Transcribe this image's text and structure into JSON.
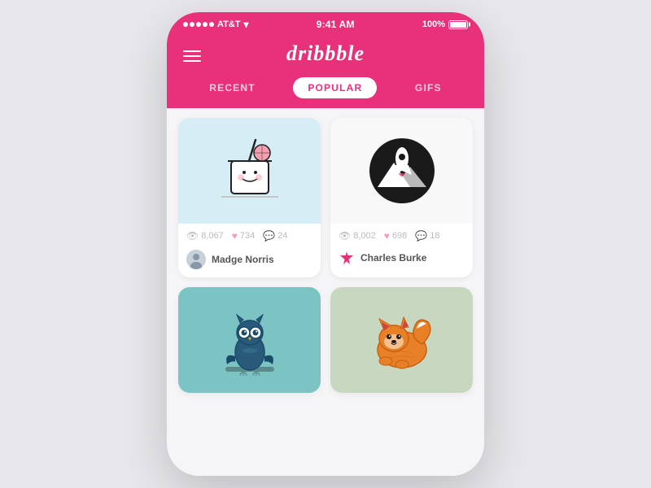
{
  "statusBar": {
    "carrier": "AT&T",
    "time": "9:41 AM",
    "battery": "100%"
  },
  "header": {
    "logo": "dribbble",
    "hamburger_label": "Menu"
  },
  "tabs": [
    {
      "label": "RECENT",
      "active": false
    },
    {
      "label": "POPULAR",
      "active": true
    },
    {
      "label": "GIFS",
      "active": false
    }
  ],
  "cards": [
    {
      "id": 1,
      "bg": "light-blue",
      "views": "8,067",
      "likes": "734",
      "comments": "24",
      "author": "Madge Norris",
      "avatar_type": "avatar1"
    },
    {
      "id": 2,
      "bg": "white-bg",
      "views": "8,002",
      "likes": "698",
      "comments": "18",
      "author": "Charles Burke",
      "avatar_type": "avatar2"
    },
    {
      "id": 3,
      "bg": "teal",
      "views": "",
      "likes": "",
      "comments": "",
      "author": "",
      "avatar_type": ""
    },
    {
      "id": 4,
      "bg": "sage",
      "views": "",
      "likes": "",
      "comments": "",
      "author": "",
      "avatar_type": ""
    }
  ],
  "icons": {
    "eye": "👁",
    "heart": "♥",
    "comment": "💬"
  }
}
